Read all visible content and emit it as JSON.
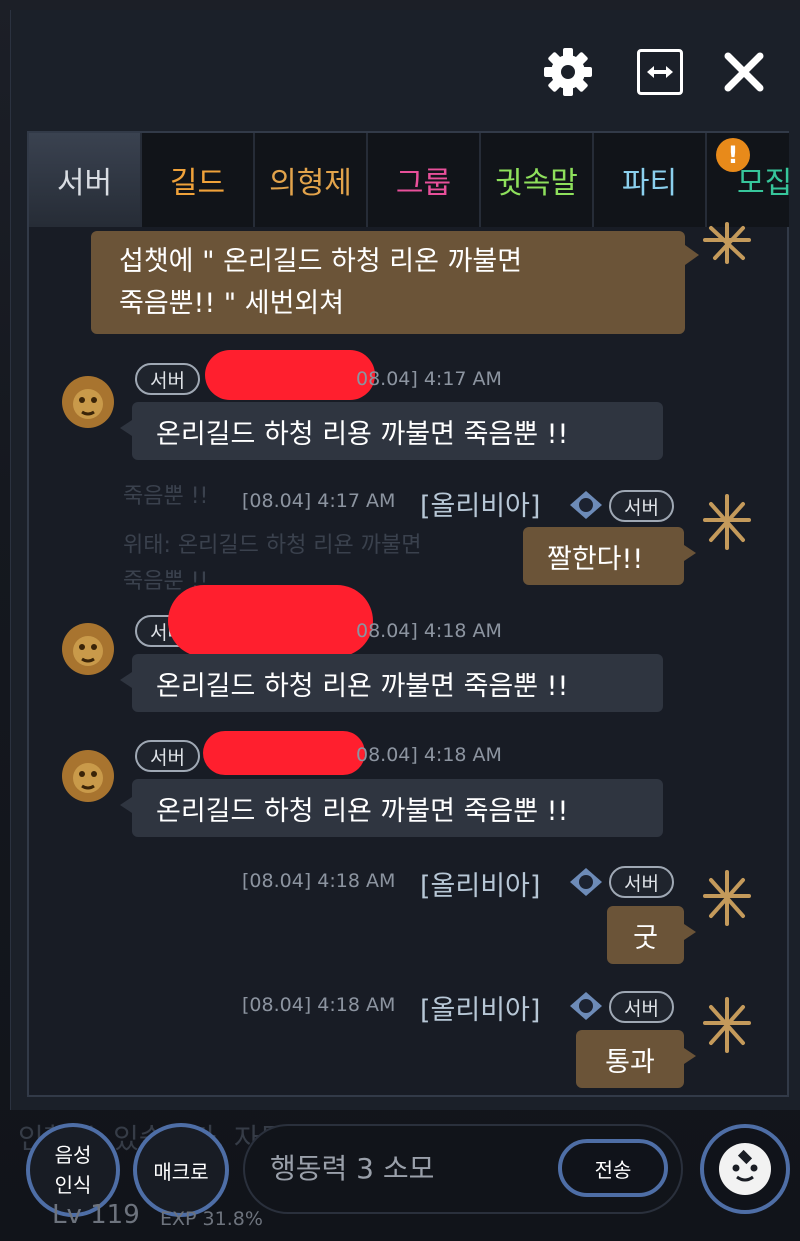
{
  "controls": {
    "settings_icon": "gear-icon",
    "expand_icon": "expand-horizontal-icon",
    "close_icon": "close-icon"
  },
  "tabs": [
    {
      "label": "서버",
      "color": "#c9ced6"
    },
    {
      "label": "길드",
      "color": "#f0a23a"
    },
    {
      "label": "의형제",
      "color": "#e2a34b"
    },
    {
      "label": "그룹",
      "color": "#e8509a"
    },
    {
      "label": "귓속말",
      "color": "#8ee05c"
    },
    {
      "label": "파티",
      "color": "#8bd0ee"
    },
    {
      "label": "모집",
      "color": "#37c69b"
    }
  ],
  "tab_alert": "!",
  "notice": {
    "line1": "섭챗에 \" 온리길드 하청 리온 까불면",
    "line2": "죽음뿐!! \"  세번외쳐"
  },
  "messages": [
    {
      "badge": "서버",
      "time": "08.04] 4:17 AM",
      "text": "온리길드 하청 리용 까불면 죽음뿐 !!"
    },
    {
      "time": "[08.04] 4:17 AM",
      "name": "[올리비아]",
      "badge": "서버",
      "text": "짤한다!!"
    },
    {
      "badge": "서버",
      "time": "08.04] 4:18 AM",
      "text": "온리길드 하청 리욘 까불면 죽음뿐 !!"
    },
    {
      "badge": "서버",
      "time": "08.04] 4:18 AM",
      "text": "온리길드 하청 리욘 까불면 죽음뿐 !!"
    },
    {
      "time": "[08.04] 4:18 AM",
      "name": "[올리비아]",
      "badge": "서버",
      "text": "굿"
    },
    {
      "time": "[08.04] 4:18 AM",
      "name": "[올리비아]",
      "badge": "서버",
      "text": "통과"
    }
  ],
  "ghost": {
    "a": "죽음뿐 !!",
    "b": "위태: 온리길드 하청 리욘 까불면",
    "c": "죽음뿐 !!"
  },
  "bottom": {
    "voice_label_1": "음성",
    "voice_label_2": "인식",
    "macro_label": "매크로",
    "input_placeholder": "행동력 3 소모",
    "send_label": "전송",
    "emoji_icon": "emoji-face-icon",
    "level": "Lv 119",
    "exp": "EXP 31.8%",
    "underlay": "인할 수 있습니다. 자동"
  }
}
